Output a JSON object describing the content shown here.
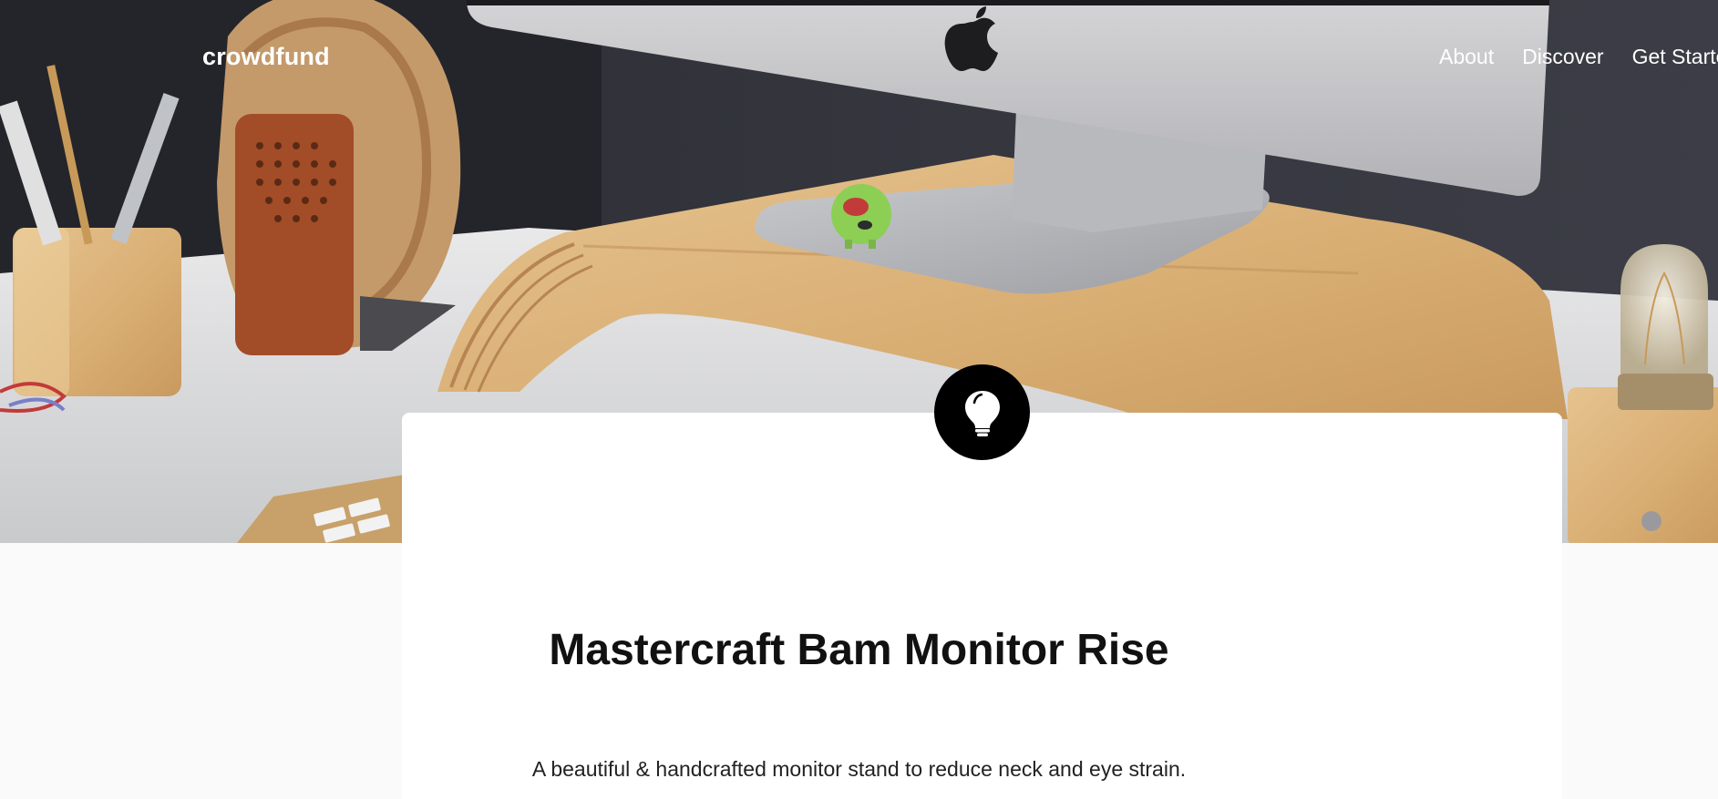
{
  "header": {
    "logo": "crowdfund",
    "nav": {
      "about": "About",
      "discover": "Discover",
      "get_started": "Get Started"
    }
  },
  "hero": {
    "image": "desk-monitor-stand-photo"
  },
  "project": {
    "icon": "lightbulb-icon",
    "title": "Mastercraft Bam Monitor Rise",
    "description": "A beautiful & handcrafted monitor stand to reduce neck and eye strain."
  },
  "colors": {
    "page_background": "#fafafa",
    "card_background": "#ffffff",
    "badge_background": "#000000",
    "nav_text": "#ffffff"
  }
}
